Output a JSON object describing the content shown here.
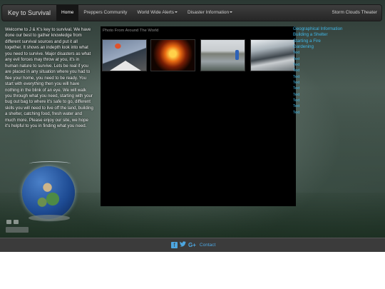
{
  "navbar": {
    "brand": "Key to Survival",
    "items": [
      {
        "label": "Home",
        "active": true
      },
      {
        "label": "Preppers Community",
        "active": false
      },
      {
        "label": "World Wide Alerts",
        "active": false,
        "dropdown": true
      },
      {
        "label": "Disaster Information",
        "active": false,
        "dropdown": true
      }
    ],
    "right_item": "Storm Clouds Theater"
  },
  "intro": {
    "text": "Welcome to J & K's key to survival. We have done our best to gather knowledge from different survival sources and put it all together. It shows an indepth look into what you need to survive. Major disasters as what any evil forces may throw at you, it's in human nature to survive. Lets be real if you are placed in any situation where you had to flee your home, you need to be ready. You start with everything then you will have nothing in the blink of an eye. We will walk you through what you need, starting with your bug out bag to where it's safe to go, different skills you will need to live off the land, building a shelter, catching food, fresh water and much more. Please enjoy our site, we hope it's helpful to you in finding what you need."
  },
  "photos": {
    "title": "Photo From Around The World",
    "items": [
      {
        "name": "volcano-photo"
      },
      {
        "name": "explosion-photo"
      },
      {
        "name": "flood-photo"
      },
      {
        "name": "tsunami-photo"
      }
    ]
  },
  "right_links": {
    "main": [
      "Geographical Information",
      "Building a Shelter",
      "Starting a Fire",
      "Gardening"
    ],
    "sub": [
      "Text",
      "Text",
      "Text",
      "Text",
      "Text",
      "Text",
      "Text",
      "Text",
      "Text",
      "Text",
      "Text"
    ]
  },
  "footer": {
    "social": {
      "facebook": "f",
      "twitter": "t",
      "google_plus": "G+"
    },
    "contact": "Contact"
  },
  "colors": {
    "link": "#3fb7e8",
    "navbar": "#2b2b2b",
    "footer": "#3b3b3b",
    "panel": "#000000"
  }
}
